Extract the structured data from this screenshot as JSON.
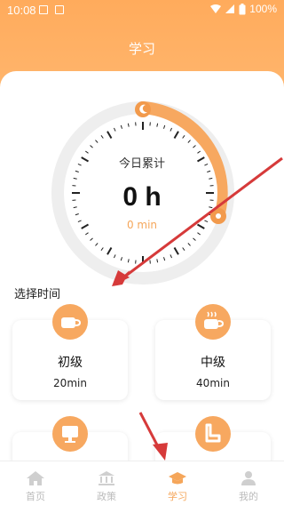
{
  "status_bar": {
    "time": "10:08",
    "battery": "100%"
  },
  "page": {
    "title": "学习"
  },
  "dial": {
    "label": "今日累计",
    "hours": "0 h",
    "minutes": "0 min"
  },
  "section": {
    "label": "选择时间"
  },
  "levels": [
    {
      "name": "初级",
      "duration": "20min",
      "icon": "coffee-cup-icon"
    },
    {
      "name": "中级",
      "duration": "40min",
      "icon": "steaming-cup-icon"
    },
    {
      "name": "",
      "duration": "",
      "icon": "monitor-icon"
    },
    {
      "name": "",
      "duration": "",
      "icon": "sofa-chair-icon"
    }
  ],
  "tabs": [
    {
      "label": "首页",
      "icon": "home-icon"
    },
    {
      "label": "政策",
      "icon": "building-icon"
    },
    {
      "label": "学习",
      "icon": "graduation-cap-icon",
      "active": true
    },
    {
      "label": "我的",
      "icon": "person-icon"
    }
  ],
  "colors": {
    "accent": "#f5a65a",
    "header": "#ffb163",
    "annotation_arrow": "#d63a3a"
  }
}
